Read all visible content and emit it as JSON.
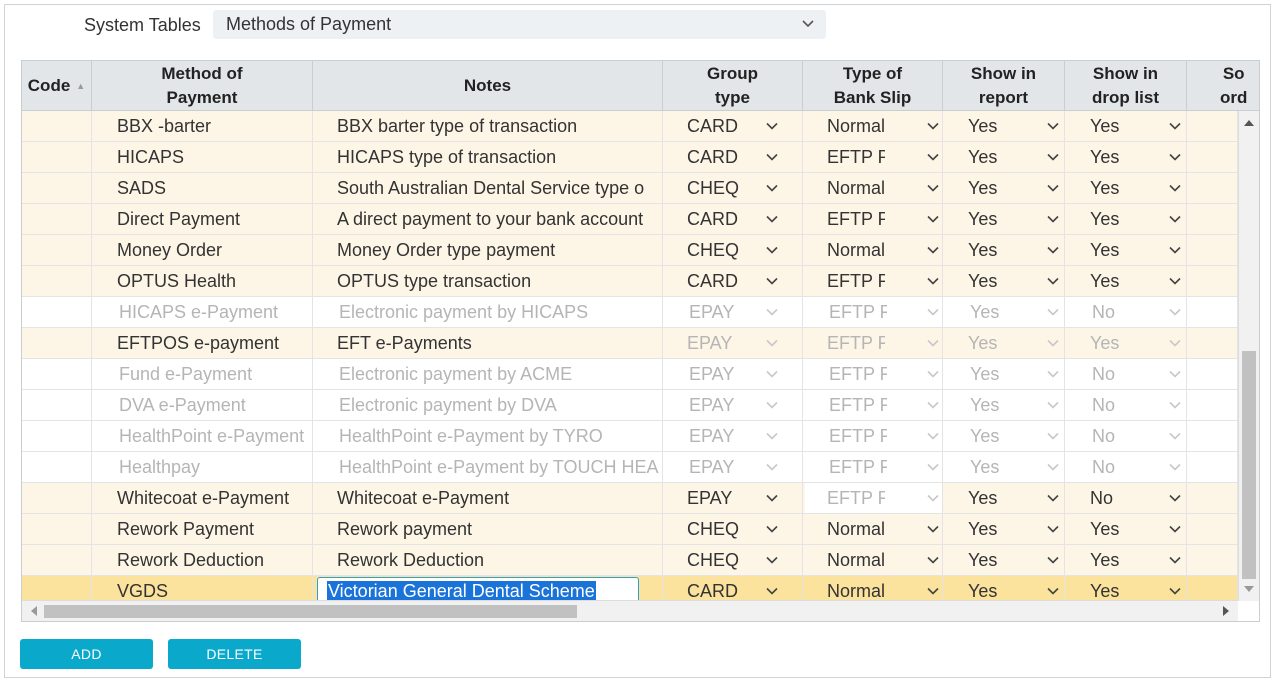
{
  "header": {
    "label": "System Tables",
    "selected_table": "Methods of Payment"
  },
  "columns": [
    "Code",
    "Method of Payment",
    "Notes",
    "Group type",
    "Type of Bank Slip",
    "Show in report",
    "Show in drop list",
    "Sort order"
  ],
  "column_lines": {
    "method": [
      "Method of",
      "Payment"
    ],
    "group": [
      "Group",
      "type"
    ],
    "bank": [
      "Type of",
      "Bank Slip"
    ],
    "report": [
      "Show in",
      "report"
    ],
    "drop": [
      "Show in",
      "drop list"
    ],
    "sort": [
      "So",
      "ord"
    ]
  },
  "rows": [
    {
      "code": "",
      "method": "BBX -barter",
      "notes": "BBX barter type of transaction",
      "group": "CARD",
      "bank": "Normal",
      "report": "Yes",
      "drop": "Yes",
      "enabled": true
    },
    {
      "code": "",
      "method": "HICAPS",
      "notes": "HICAPS type of transaction",
      "group": "CARD",
      "bank": "EFTP P",
      "report": "Yes",
      "drop": "Yes",
      "enabled": true
    },
    {
      "code": "",
      "method": "SADS",
      "notes": "South Australian Dental Service type o",
      "group": "CHEQ",
      "bank": "Normal",
      "report": "Yes",
      "drop": "Yes",
      "enabled": true
    },
    {
      "code": "",
      "method": "Direct Payment",
      "notes": "A direct payment to your bank account",
      "group": "CARD",
      "bank": "EFTP P",
      "report": "Yes",
      "drop": "Yes",
      "enabled": true
    },
    {
      "code": "",
      "method": "Money Order",
      "notes": "Money Order type payment",
      "group": "CHEQ",
      "bank": "Normal",
      "report": "Yes",
      "drop": "Yes",
      "enabled": true
    },
    {
      "code": "",
      "method": "OPTUS Health",
      "notes": "OPTUS type transaction",
      "group": "CARD",
      "bank": "EFTP P",
      "report": "Yes",
      "drop": "Yes",
      "enabled": true
    },
    {
      "code": "",
      "method": "HICAPS e-Payment",
      "notes": "Electronic payment by HICAPS",
      "group": "EPAY",
      "bank": "EFTP F",
      "report": "Yes",
      "drop": "No",
      "enabled": false
    },
    {
      "code": "",
      "method": "EFTPOS e-payment",
      "notes": "EFT e-Payments",
      "group": "EPAY",
      "bank": "EFTP F",
      "report": "Yes",
      "drop": "Yes",
      "enabled": "partial"
    },
    {
      "code": "",
      "method": "Fund e-Payment",
      "notes": "Electronic payment by ACME",
      "group": "EPAY",
      "bank": "EFTP F",
      "report": "Yes",
      "drop": "No",
      "enabled": false
    },
    {
      "code": "",
      "method": "DVA e-Payment",
      "notes": "Electronic payment by DVA",
      "group": "EPAY",
      "bank": "EFTP F",
      "report": "Yes",
      "drop": "No",
      "enabled": false
    },
    {
      "code": "",
      "method": "HealthPoint e-Payment",
      "notes": "HealthPoint e-Payment by TYRO",
      "group": "EPAY",
      "bank": "EFTP F",
      "report": "Yes",
      "drop": "No",
      "enabled": false
    },
    {
      "code": "",
      "method": "Healthpay",
      "notes": "HealthPoint e-Payment by TOUCH HEA",
      "group": "EPAY",
      "bank": "EFTP F",
      "report": "Yes",
      "drop": "No",
      "enabled": false
    },
    {
      "code": "",
      "method": "Whitecoat e-Payment",
      "notes": "Whitecoat e-Payment",
      "group": "EPAY",
      "bank": "EFTP F",
      "report": "Yes",
      "drop": "No",
      "enabled": "bank-disabled"
    },
    {
      "code": "",
      "method": "Rework Payment",
      "notes": "Rework payment",
      "group": "CHEQ",
      "bank": "Normal",
      "report": "Yes",
      "drop": "Yes",
      "enabled": true
    },
    {
      "code": "",
      "method": "Rework Deduction",
      "notes": "Rework Deduction",
      "group": "CHEQ",
      "bank": "Normal",
      "report": "Yes",
      "drop": "Yes",
      "enabled": true
    },
    {
      "code": "",
      "method": "VGDS",
      "notes": "Victorian General Dental Scheme",
      "group": "CARD",
      "bank": "Normal",
      "report": "Yes",
      "drop": "Yes",
      "enabled": true,
      "selected": true,
      "editing": "notes"
    }
  ],
  "buttons": {
    "add": "ADD",
    "delete": "DELETE"
  },
  "colors": {
    "row_enabled": "#fdf6e7",
    "row_selected": "#fbe39d",
    "button": "#0aa9cc",
    "selection": "#1a73d9"
  },
  "icons": {
    "dropdown": "chevron-down-icon",
    "sort": "sort-ascending-icon"
  }
}
